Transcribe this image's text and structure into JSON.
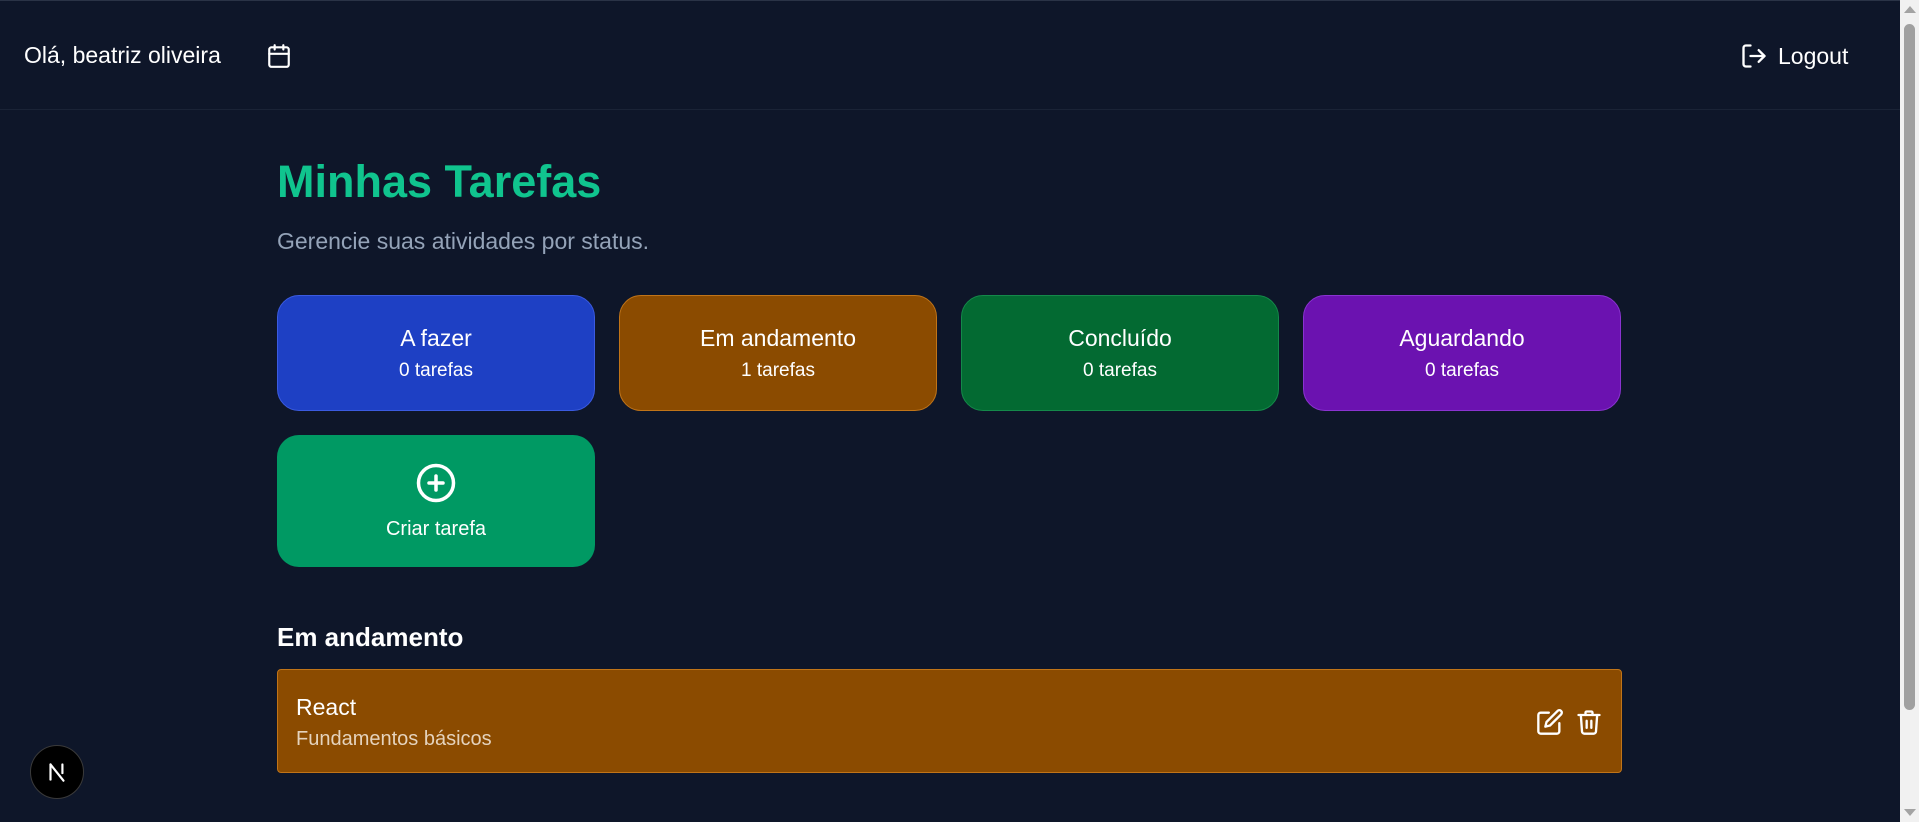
{
  "header": {
    "greeting": "Olá, beatriz oliveira",
    "calendar_icon": "calendar-icon",
    "logout_label": "Logout",
    "logout_icon": "logout-icon"
  },
  "main": {
    "title": "Minhas Tarefas",
    "subtitle": "Gerencie suas atividades por status."
  },
  "status_cards": [
    {
      "label": "A fazer",
      "count": "0 tarefas",
      "color": "#1e40c4"
    },
    {
      "label": "Em andamento",
      "count": "1 tarefas",
      "color": "#8b4b00"
    },
    {
      "label": "Concluído",
      "count": "0 tarefas",
      "color": "#036a32"
    },
    {
      "label": "Aguardando",
      "count": "0 tarefas",
      "color": "#6b12b0"
    }
  ],
  "create": {
    "label": "Criar tarefa",
    "icon": "plus-circle-icon",
    "color": "#009963"
  },
  "section": {
    "title": "Em andamento",
    "tasks": [
      {
        "title": "React",
        "description": "Fundamentos básicos"
      }
    ]
  },
  "badge": {
    "letter": "N"
  },
  "colors": {
    "background": "#0e1629",
    "accent": "#10c48e",
    "subtitle": "#94a3b8"
  }
}
